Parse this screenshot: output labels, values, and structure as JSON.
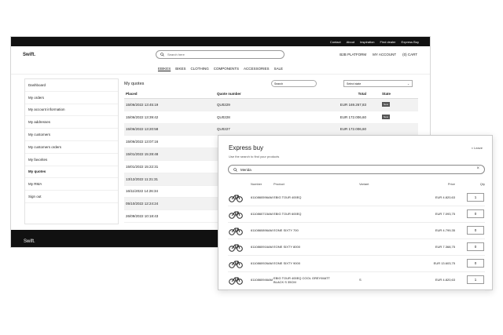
{
  "topbar": {
    "links": [
      "Contact",
      "About",
      "Inspiration",
      "Find dealer",
      "Express Buy"
    ]
  },
  "header": {
    "logo": "Swift.",
    "search_placeholder": "Search here",
    "b2b": "B2B PLATFORM",
    "account": "MY ACCOUNT",
    "cart": "(0) CART"
  },
  "nav": {
    "items": [
      "EBIKES",
      "BIKES",
      "CLOTHING",
      "COMPONENTS",
      "ACCESSORIES",
      "SALE"
    ]
  },
  "sidebar": {
    "items": [
      "Dashboard",
      "My orders",
      "My account information",
      "My addresses",
      "My customers",
      "My customers orders",
      "My favorites",
      "My quotes",
      "My RMA",
      "Sign out"
    ]
  },
  "quotes": {
    "title": "My quotes",
    "search_placeholder": "Search",
    "select_placeholder": "Select state",
    "headers": {
      "placed": "Placed",
      "quote": "Quote number",
      "total": "Total",
      "state": "State"
    },
    "rows": [
      {
        "placed": "15/06/2022 13:45:19",
        "quote": "QU0229",
        "total": "EUR 169.267,83",
        "state": "New"
      },
      {
        "placed": "15/06/2022 13:39:42",
        "quote": "QU0228",
        "total": "EUR 172.006,60",
        "state": "New"
      },
      {
        "placed": "15/06/2022 13:20:58",
        "quote": "QU0227",
        "total": "EUR 172.006,60",
        "state": ""
      },
      {
        "placed": "15/06/2022 13:07:16",
        "quote": "",
        "total": "",
        "state": ""
      },
      {
        "placed": "15/01/2022 15:28:48",
        "quote": "",
        "total": "",
        "state": ""
      },
      {
        "placed": "15/01/2022 15:22:31",
        "quote": "",
        "total": "",
        "state": ""
      },
      {
        "placed": "13/12/2022 11:21:31",
        "quote": "",
        "total": "",
        "state": ""
      },
      {
        "placed": "16/11/2022 14:26:34",
        "quote": "",
        "total": "",
        "state": ""
      },
      {
        "placed": "05/10/2022 12:24:24",
        "quote": "",
        "total": "",
        "state": ""
      },
      {
        "placed": "26/09/2022 10:18:43",
        "quote": "",
        "total": "",
        "state": ""
      }
    ]
  },
  "footer": {
    "logo": "Swift."
  },
  "express": {
    "title": "Express buy",
    "subtitle": "Use the search to find your products",
    "close": "Leave",
    "search_value": "Merida",
    "headers": {
      "number": "Number",
      "product": "Product",
      "variant": "Variant",
      "price": "Price",
      "qty": "Qty"
    },
    "rows": [
      {
        "number": "6110860596AM",
        "product": "EBIG TOUR 400EQ",
        "variant": "",
        "price": "EUR 4.820,63",
        "qty": "1"
      },
      {
        "number": "6110860715AM",
        "product": "EBIG TOUR 600EQ",
        "variant": "",
        "price": "EUR 7.093,75",
        "qty": "0"
      },
      {
        "number": "6110860896AM",
        "product": "EONE SIXTY 700",
        "variant": "",
        "price": "EUR 4.799,35",
        "qty": "0"
      },
      {
        "number": "6110860916AM",
        "product": "EONE SIXTY 8000",
        "variant": "",
        "price": "EUR 7.368,75",
        "qty": "0"
      },
      {
        "number": "6110860926AM",
        "product": "EONE SIXTY 9000",
        "variant": "",
        "price": "EUR 13.603,75",
        "qty": "0"
      },
      {
        "number": "6110860946AM",
        "product": "EBIG TOUR 400EQ COOL GREY/MATT BLACK S 35CM",
        "variant": "S",
        "price": "EUR 4.820,63",
        "qty": "1"
      }
    ]
  }
}
